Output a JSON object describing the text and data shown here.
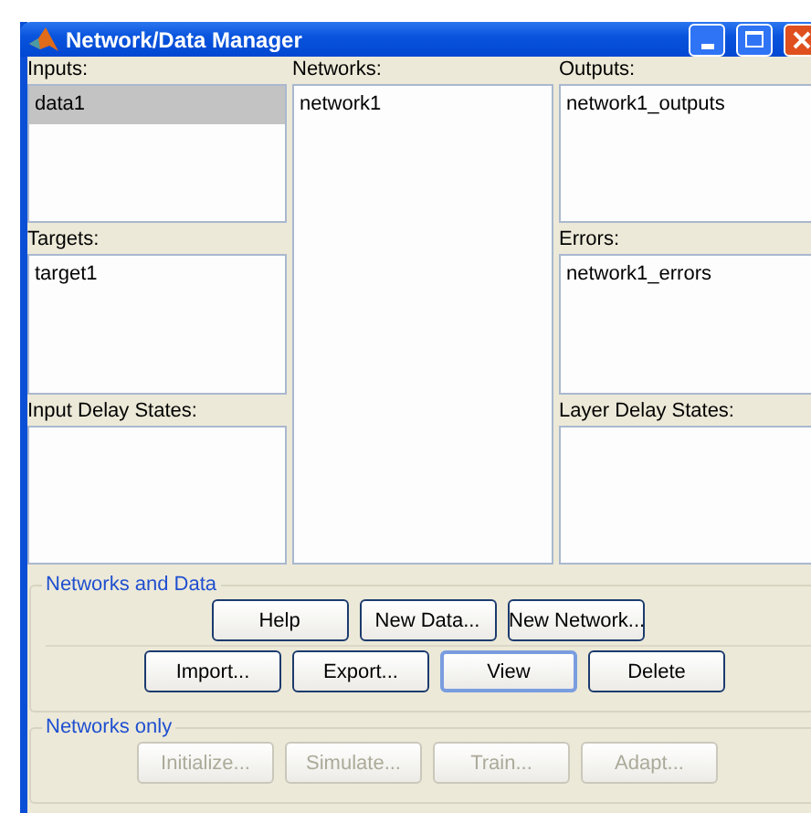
{
  "window": {
    "title": "Network/Data Manager"
  },
  "columns": [
    {
      "sections": [
        {
          "label": "Inputs:",
          "items": [
            {
              "text": "data1",
              "selected": true
            }
          ]
        },
        {
          "label": "Targets:",
          "items": [
            {
              "text": "target1",
              "selected": false
            }
          ]
        },
        {
          "label": "Input Delay States:"
        }
      ]
    },
    {
      "sections": [
        {
          "label": "Networks:",
          "items": [
            {
              "text": "network1",
              "selected": false
            }
          ]
        }
      ]
    },
    {
      "sections": [
        {
          "label": "Outputs:",
          "items": [
            {
              "text": "network1_outputs",
              "selected": false
            }
          ]
        },
        {
          "label": "Errors:",
          "items": [
            {
              "text": "network1_errors",
              "selected": false
            }
          ]
        },
        {
          "label": "Layer Delay States:"
        }
      ]
    }
  ],
  "groups": [
    {
      "title": "Networks and Data",
      "rows": [
        [
          {
            "label": "Help",
            "disabled": false,
            "focused": false
          },
          {
            "label": "New Data...",
            "disabled": false,
            "focused": false
          },
          {
            "label": "New Network...",
            "disabled": false,
            "focused": false
          }
        ],
        [
          {
            "label": "Import...",
            "disabled": false,
            "focused": false
          },
          {
            "label": "Export...",
            "disabled": false,
            "focused": false
          },
          {
            "label": "View",
            "disabled": false,
            "focused": true
          },
          {
            "label": "Delete",
            "disabled": false,
            "focused": false
          }
        ]
      ]
    },
    {
      "title": "Networks only",
      "rows": [
        [
          {
            "label": "Initialize...",
            "disabled": true,
            "focused": false
          },
          {
            "label": "Simulate...",
            "disabled": true,
            "focused": false
          },
          {
            "label": "Train...",
            "disabled": true,
            "focused": false
          },
          {
            "label": "Adapt...",
            "disabled": true,
            "focused": false
          }
        ]
      ]
    }
  ]
}
